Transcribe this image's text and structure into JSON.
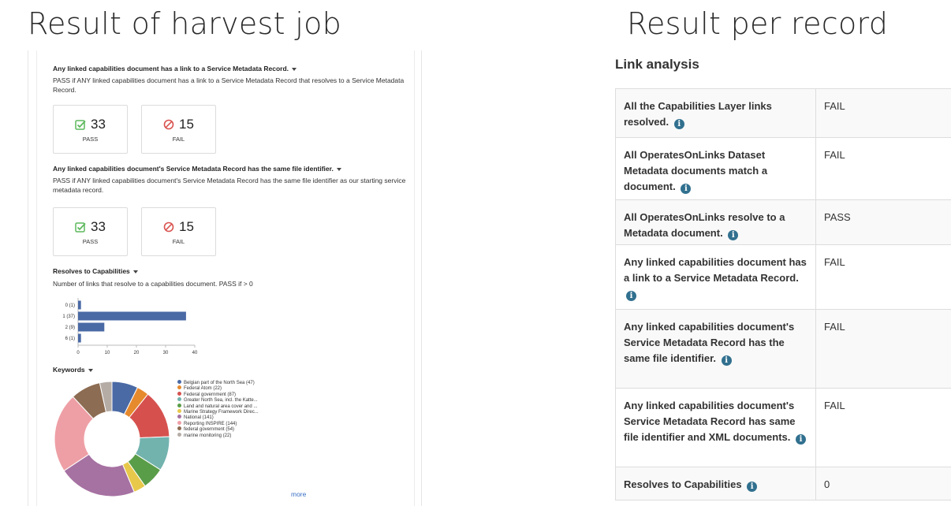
{
  "titles": {
    "left": "Result of harvest job",
    "right": "Result per record"
  },
  "harvest": {
    "sections": [
      {
        "heading": "Any linked capabilities document has a link to a Service Metadata Record.",
        "description": "PASS if ANY linked capabilities document has a link to a Service Metadata Record that resolves to a Service Metadata Record.",
        "pass_count": "33",
        "pass_label": "PASS",
        "fail_count": "15",
        "fail_label": "FAIL"
      },
      {
        "heading": "Any linked capabilities document's Service Metadata Record has the same file identifier.",
        "description": "PASS if ANY linked capabilities document's Service Metadata Record has the same file identifier as our starting service metadata record.",
        "pass_count": "33",
        "pass_label": "PASS",
        "fail_count": "15",
        "fail_label": "FAIL"
      }
    ],
    "resolves": {
      "heading": "Resolves to Capabilities",
      "description": "Number of links that resolve to a capabilities document. PASS if > 0"
    },
    "keywords": {
      "heading": "Keywords",
      "more_label": "more"
    }
  },
  "chart_data": [
    {
      "type": "bar",
      "orientation": "horizontal",
      "categories": [
        "0 (1)",
        "1 (37)",
        "2 (9)",
        "6 (1)"
      ],
      "values": [
        1,
        37,
        9,
        1
      ],
      "xticks": [
        "0",
        "10",
        "20",
        "30",
        "40"
      ],
      "xlim": [
        0,
        40
      ],
      "color": "#4a6aa5"
    },
    {
      "type": "pie",
      "donut": true,
      "labels": [
        "Belgian part of the North Sea (47)",
        "Federal Atom (22)",
        "Federal government (87)",
        "Greater North Sea, incl. the Katte...",
        "Land and natural area cover and ...",
        "Marine Strategy Framework Direc...",
        "National (141)",
        "Reporting INSPIRE (144)",
        "federal government (54)",
        "marine monitoring (22)"
      ],
      "values": [
        47,
        22,
        87,
        62,
        40,
        22,
        141,
        144,
        54,
        22
      ],
      "colors": [
        "#4a6aa5",
        "#e68a2e",
        "#d6514e",
        "#72b3ae",
        "#5a9d48",
        "#e8c84a",
        "#a672a2",
        "#ee9fa5",
        "#8c6c52",
        "#b5aca6"
      ]
    }
  ],
  "link_analysis": {
    "heading": "Link analysis",
    "rows": [
      {
        "label": "All the Capabilities Layer links resolved.",
        "value": "FAIL",
        "status": "fail"
      },
      {
        "label": "All OperatesOnLinks Dataset Metadata documents match a document.",
        "value": "FAIL",
        "status": "fail"
      },
      {
        "label": "All OperatesOnLinks resolve to a Metadata document.",
        "value": "PASS",
        "status": "pass"
      },
      {
        "label": "Any linked capabilities document has a link to a Service Metadata Record.",
        "value": "FAIL",
        "status": "fail"
      },
      {
        "label": "Any linked capabilities document's Service Metadata Record has the same file identifier.",
        "value": "FAIL",
        "status": "fail"
      },
      {
        "label": "Any linked capabilities document's Service Metadata Record has same file identifier and XML documents.",
        "value": "FAIL",
        "status": "fail"
      },
      {
        "label": "Resolves to Capabilities",
        "value": "0",
        "status": "neutral"
      }
    ],
    "info_glyph": "i",
    "colors": {
      "fail": "#a94442",
      "pass": "#3c763d",
      "info": "#31708f"
    }
  }
}
